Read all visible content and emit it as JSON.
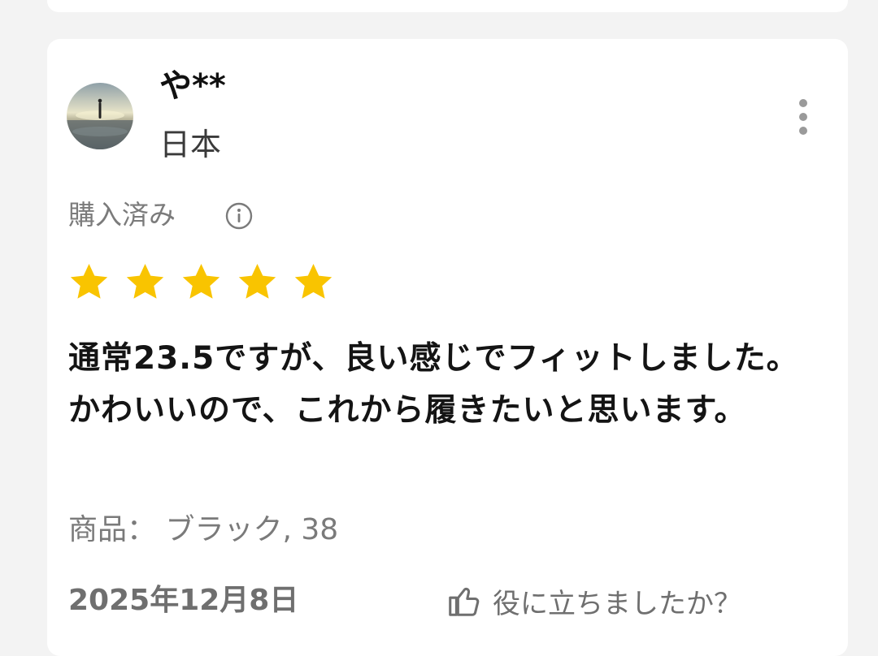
{
  "review": {
    "user": {
      "name": "や**",
      "country": "日本",
      "avatar": "avatar-photo-silhouette-on-shore"
    },
    "purchased_label": "購入済み",
    "rating": 5,
    "rating_max": 5,
    "text": "通常23.5ですが、良い感じでフィットしました。かわいいので、これから履きたいと思います。",
    "product_label": "商品：",
    "product_value": "ブラック, 38",
    "date": "2025年12月8日",
    "helpful_label": "役に立ちましたか？"
  },
  "icons": {
    "more": "more-vertical-icon",
    "info": "info-icon",
    "star": "star-icon",
    "thumbs_up": "thumbs-up-icon"
  },
  "colors": {
    "star": "#F9C400",
    "text_primary": "#141414",
    "text_secondary": "#7a7a7a",
    "card_background": "#ffffff",
    "page_background": "#f3f3f3"
  }
}
